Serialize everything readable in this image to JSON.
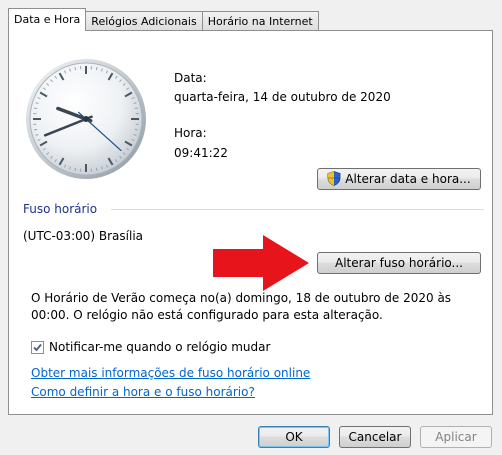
{
  "tabs": [
    {
      "label": "Data e Hora",
      "active": true
    },
    {
      "label": "Relógios Adicionais",
      "active": false
    },
    {
      "label": "Horário na Internet",
      "active": false
    }
  ],
  "date_section": {
    "date_label": "Data:",
    "date_value": "quarta-feira, 14 de outubro de 2020",
    "time_label": "Hora:",
    "time_value": "09:41:22",
    "change_button": "Alterar data e hora..."
  },
  "timezone_section": {
    "group_label": "Fuso horário",
    "current_zone": "(UTC-03:00) Brasília",
    "change_button": "Alterar fuso horário...",
    "dst_notice": "O Horário de Verão começa no(a) domingo, 18 de outubro de 2020 às 00:00. O relógio não está configurado para esta alteração."
  },
  "notify_checkbox": {
    "label": "Notificar-me quando o relógio mudar",
    "checked": true
  },
  "links": {
    "more_info": "Obter mais informações de fuso horário online",
    "how_to": "Como definir a hora e o fuso horário?"
  },
  "footer": {
    "ok": "OK",
    "cancel": "Cancelar",
    "apply": "Aplicar"
  },
  "clock": {
    "hours": 9,
    "minutes": 41,
    "seconds": 22
  },
  "colors": {
    "link": "#0066cc",
    "arrow": "#e8141b"
  }
}
